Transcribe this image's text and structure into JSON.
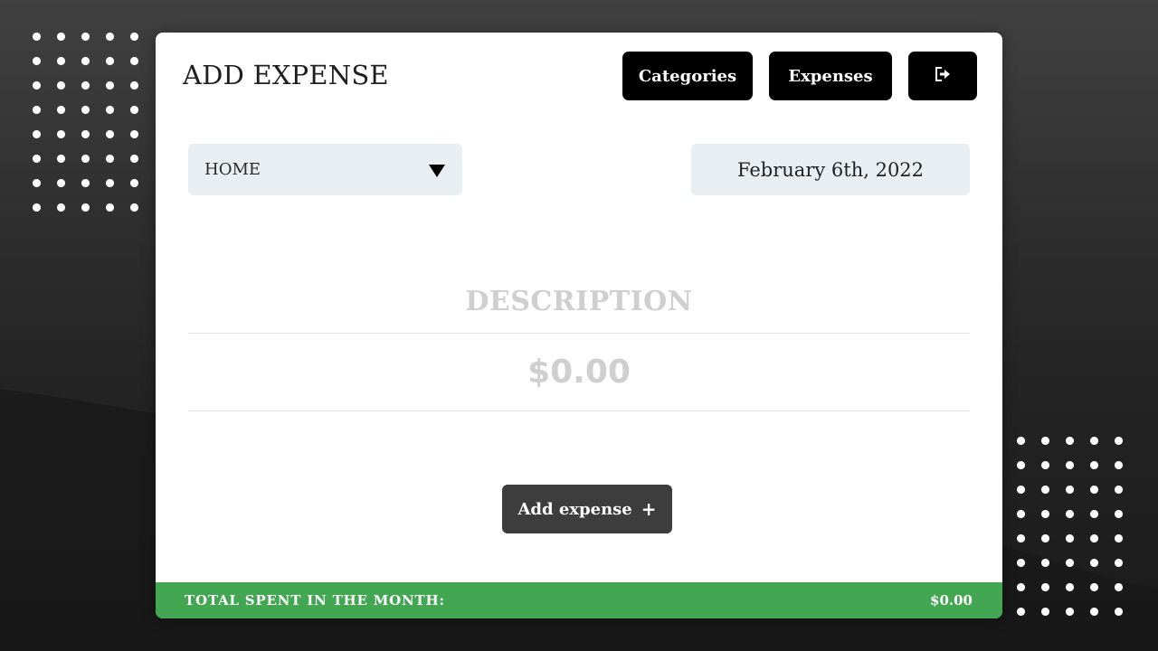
{
  "page": {
    "title": "ADD EXPENSE"
  },
  "nav": {
    "categories_label": "Categories",
    "expenses_label": "Expenses",
    "logout_icon": "logout-icon"
  },
  "form": {
    "category": {
      "selected": "HOME",
      "arrow_icon": "triangle-down-icon"
    },
    "date": "February 6th, 2022",
    "description_placeholder": "DESCRIPTION",
    "amount_placeholder": "$0.00",
    "add_button_label": "Add expense",
    "add_icon": "plus-icon"
  },
  "footer": {
    "label": "TOTAL SPENT IN THE MONTH:",
    "total": "$0.00"
  },
  "colors": {
    "primary_button": "#000000",
    "add_button": "#3d3d3d",
    "input_background": "#e8eef1",
    "footer_green": "#43a653"
  }
}
